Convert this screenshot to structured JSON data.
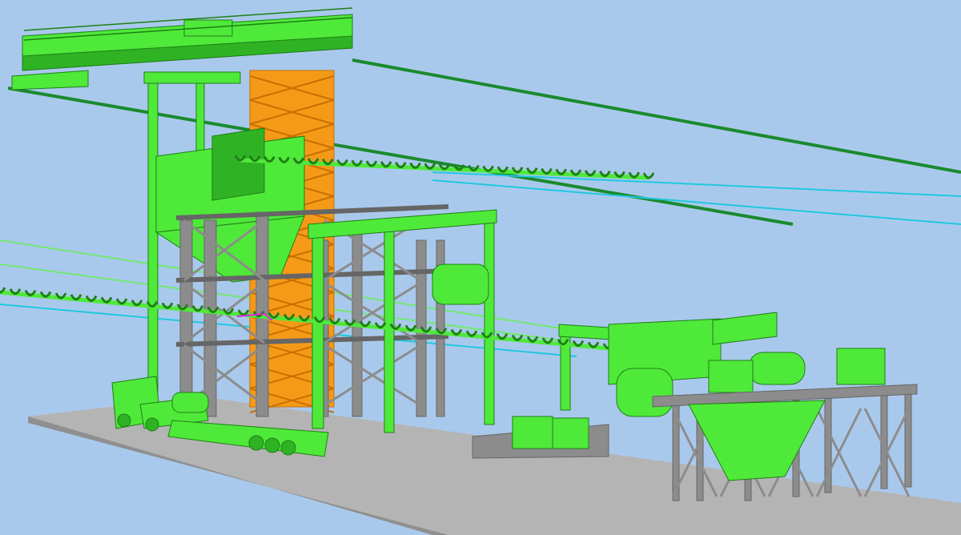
{
  "scene": {
    "description_name": "3d-cad-plant-model",
    "background_color": "#a9c9ec",
    "colors": {
      "equipment": "#4fe93a",
      "equipment_dark": "#2fb324",
      "equipment_outline": "#1f7f16",
      "steel": "#8c8c8c",
      "steel_dark": "#666666",
      "tower": "#f59a18",
      "tower_dark": "#c86f00",
      "ground": "#b4b4b4",
      "ground_edge": "#8f8f8f",
      "cable_dark": "#1a8a2e",
      "cable_cyan": "#20c8e0",
      "cable_light": "#72e872",
      "accent_magenta": "#e020e0"
    }
  }
}
